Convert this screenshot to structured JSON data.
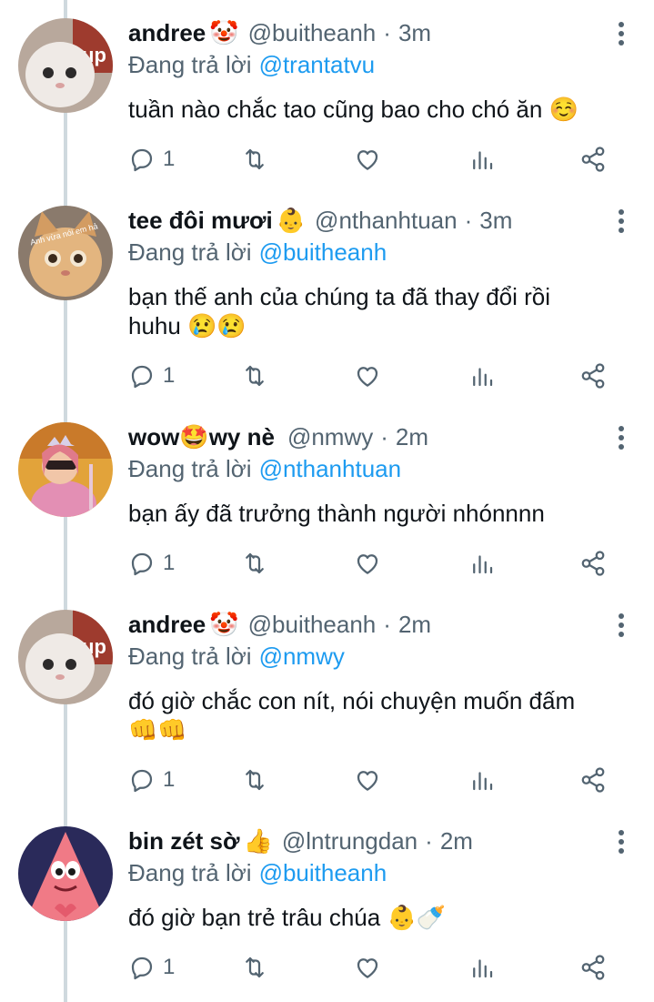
{
  "tweets": [
    {
      "name": "andree",
      "name_emoji": "🤡",
      "handle": "@buitheanh",
      "time": "3m",
      "replying_label": "Đang trả lời",
      "replying_to": "@trantatvu",
      "text": "tuần nào chắc tao cũng bao cho chó ăn ☺️",
      "reply_count": "1"
    },
    {
      "name": "tee đôi mươi",
      "name_emoji": "👶",
      "handle": "@nthanhtuan",
      "time": "3m",
      "replying_label": "Đang trả lời",
      "replying_to": "@buitheanh",
      "text": "bạn thế anh của chúng ta đã thay đổi rồi huhu 😢😢",
      "reply_count": "1",
      "avatar_caption": "Anh vừa nói em hả"
    },
    {
      "name": "wow🤩wy nè",
      "name_emoji": "",
      "handle": "@nmwy",
      "time": "2m",
      "replying_label": "Đang trả lời",
      "replying_to": "@nthanhtuan",
      "text": "bạn ấy đã trưởng thành người nhónnnn",
      "reply_count": "1"
    },
    {
      "name": "andree",
      "name_emoji": "🤡",
      "handle": "@buitheanh",
      "time": "2m",
      "replying_label": "Đang trả lời",
      "replying_to": "@nmwy",
      "text": "đó giờ chắc con nít, nói chuyện muốn đấm 👊👊",
      "reply_count": "1"
    },
    {
      "name": "bin zét sờ",
      "name_emoji": "👍",
      "handle": "@lntrungdan",
      "time": "2m",
      "replying_label": "Đang trả lời",
      "replying_to": "@buitheanh",
      "text": "đó giờ bạn trẻ trâu chúa 👶🍼",
      "reply_count": "1"
    }
  ],
  "colors": {
    "accent": "#1d9bf0",
    "muted": "#536471",
    "text": "#0f1419",
    "thread_line": "#cfd9de"
  },
  "icons": [
    "reply-icon",
    "retweet-icon",
    "like-icon",
    "views-icon",
    "share-icon",
    "more-icon"
  ]
}
